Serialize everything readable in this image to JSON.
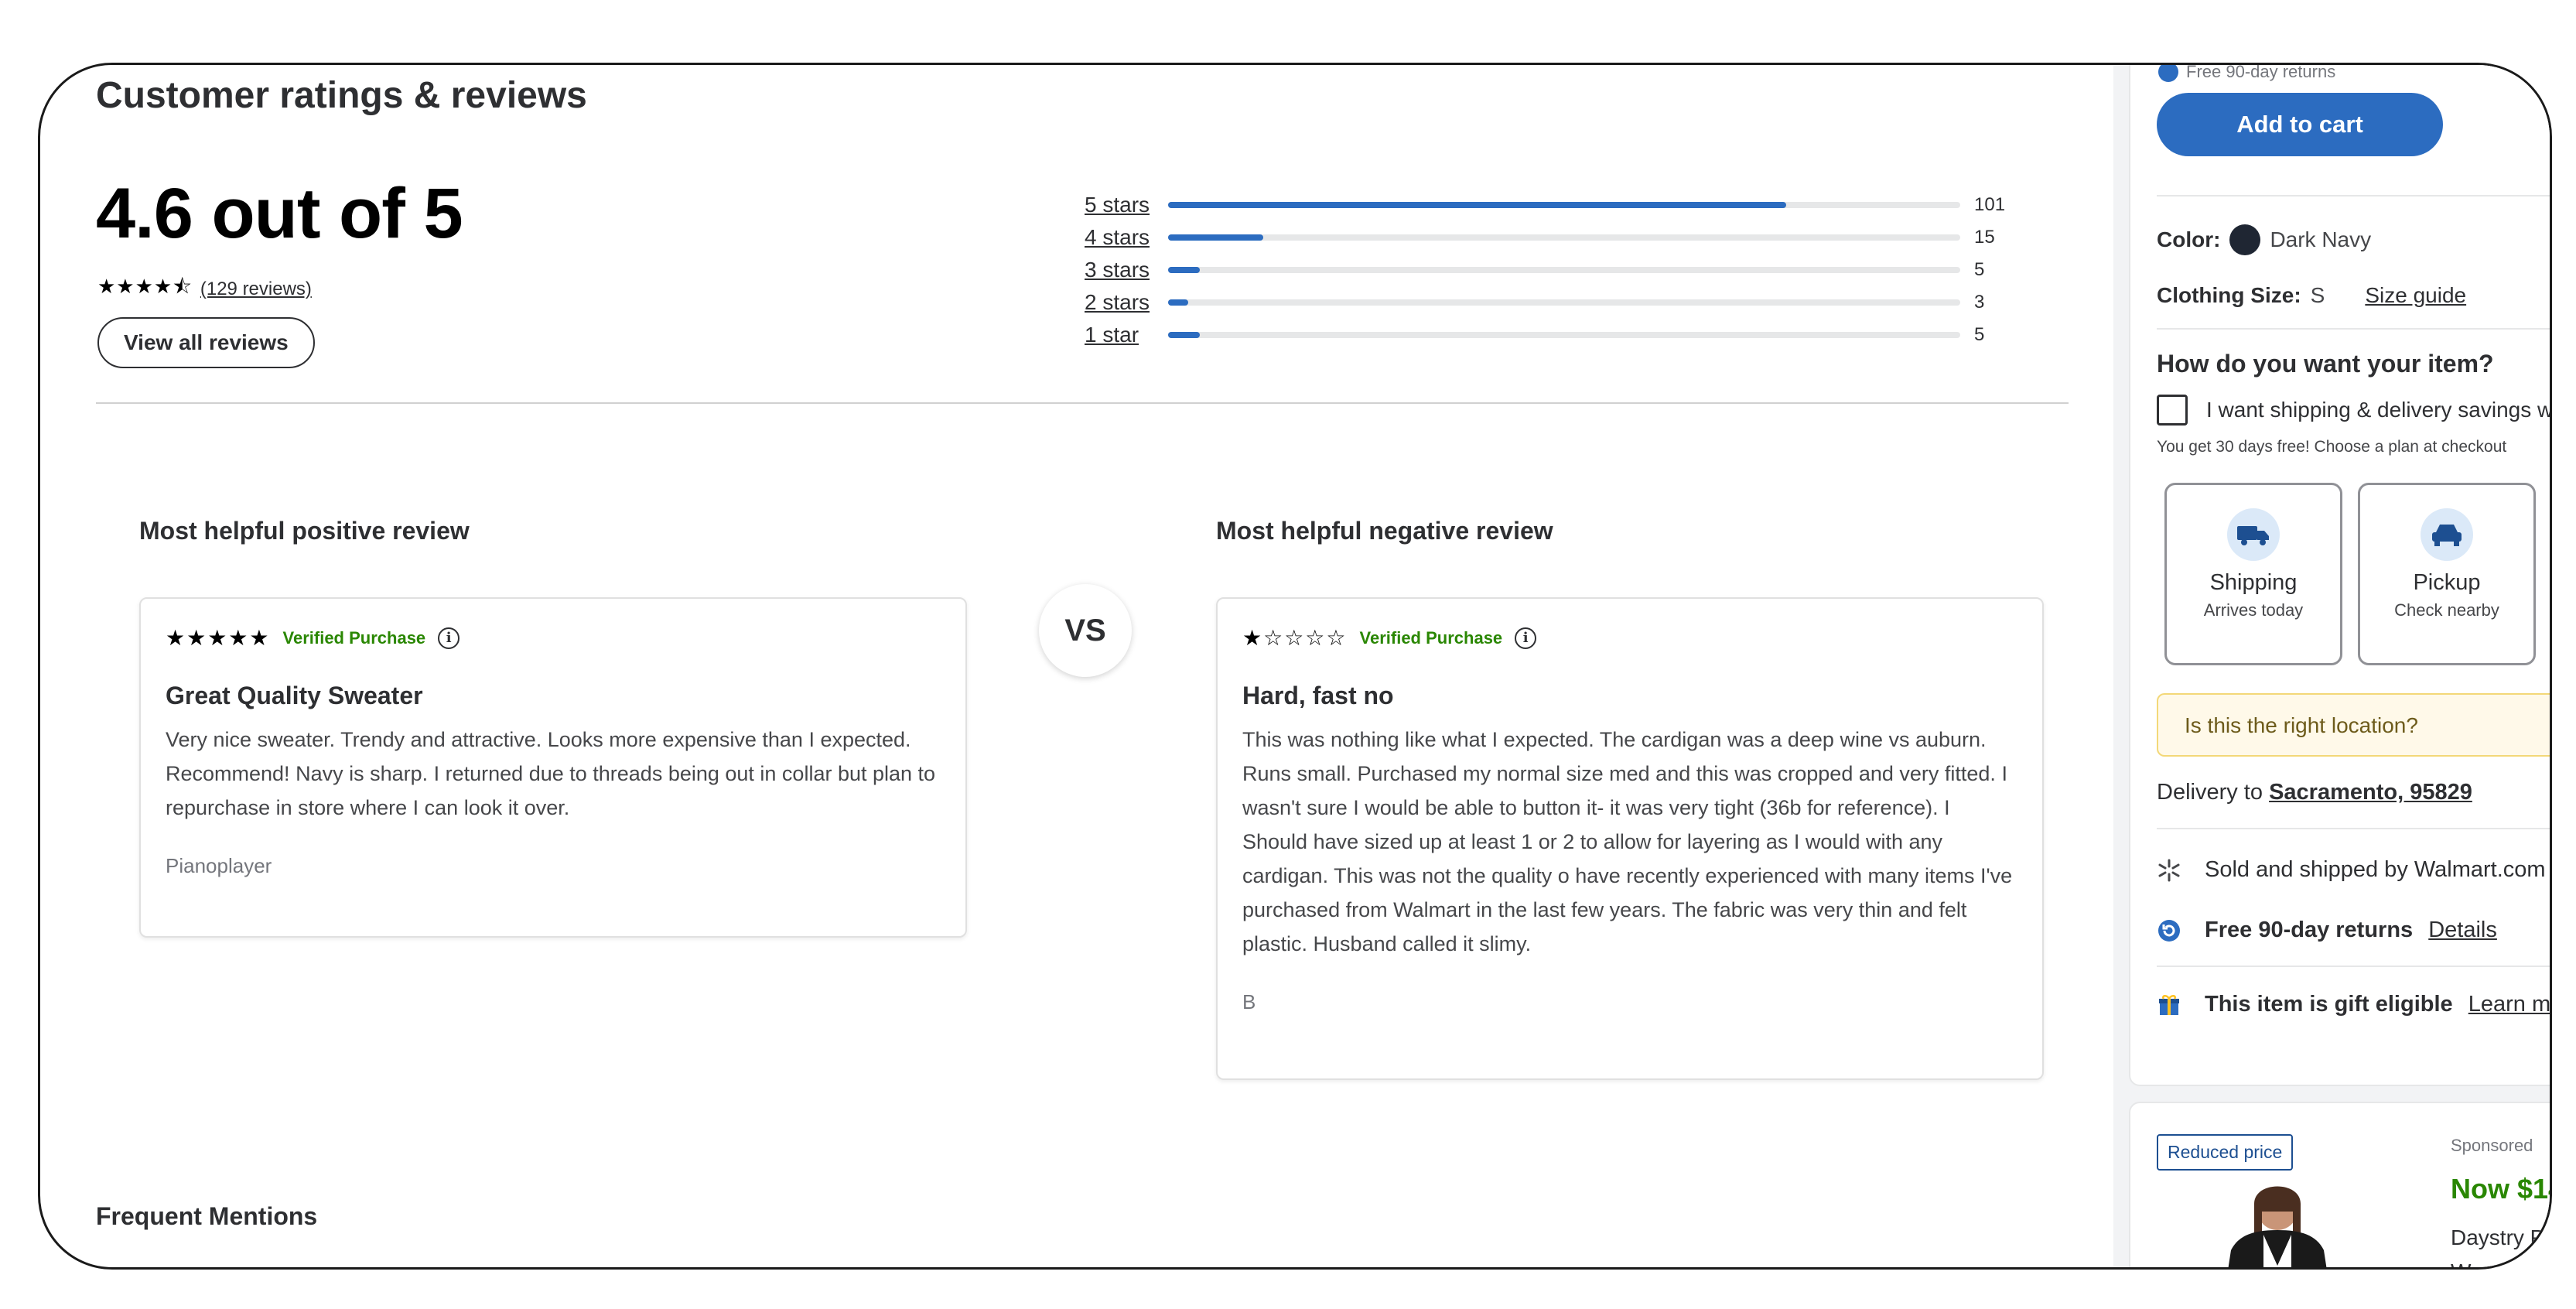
{
  "reviews": {
    "section_title": "Customer ratings & reviews",
    "average_text": "4.6 out of 5",
    "average_value": 4.6,
    "stars_display": "★★★★⯪",
    "count_text": "(129 reviews)",
    "view_all_label": "View all reviews",
    "histogram": [
      {
        "label": "5 stars",
        "count": "101",
        "fraction": 0.78
      },
      {
        "label": "4 stars",
        "count": "15",
        "fraction": 0.12
      },
      {
        "label": "3 stars",
        "count": "5",
        "fraction": 0.04
      },
      {
        "label": "2 stars",
        "count": "3",
        "fraction": 0.025
      },
      {
        "label": "1 star",
        "count": "5",
        "fraction": 0.04
      }
    ],
    "positive": {
      "heading": "Most helpful positive review",
      "stars": "★★★★★",
      "rating": 5,
      "verified": "Verified Purchase",
      "title": "Great Quality Sweater",
      "body": "Very nice sweater. Trendy and attractive. Looks more expensive than I expected. Recommend! Navy is sharp. I returned due to threads being out in collar but plan to repurchase in store where I can look it over.",
      "author": "Pianoplayer"
    },
    "vs_label": "VS",
    "negative": {
      "heading": "Most helpful negative review",
      "stars": "★☆☆☆☆",
      "rating": 1,
      "verified": "Verified Purchase",
      "title": "Hard, fast no",
      "body": "This was nothing like what I expected. The cardigan was a deep wine vs auburn. Runs small. Purchased my normal size med and this was cropped and very fitted. I wasn't sure I would be able to button it- it was very tight (36b for reference). I Should have sized up at least 1 or 2 to allow for layering as I would with any cardigan. This was not the quality o have recently experienced with many items I've purchased from Walmart in the last few years. The fabric was very thin and felt plastic. Husband called it slimy.",
      "author": "B"
    },
    "frequent_mentions": "Frequent Mentions"
  },
  "buybox": {
    "top_returns": "Free 90-day returns",
    "add_to_cart": "Add to cart",
    "color_label": "Color:",
    "color_value": "Dark Navy",
    "color_hex": "#1f2633",
    "size_label": "Clothing Size:",
    "size_value": "S",
    "size_guide": "Size guide",
    "how_heading": "How do you want your item?",
    "savings_label": "I want shipping & delivery savings wi",
    "savings_note": "You get 30 days free! Choose a plan at checkout",
    "options": [
      {
        "name": "Shipping",
        "sub": "Arrives today",
        "icon": "truck-icon"
      },
      {
        "name": "Pickup",
        "sub": "Check nearby",
        "icon": "car-icon"
      }
    ],
    "location_prompt": "Is this the right location?",
    "delivery_prefix": "Delivery to",
    "delivery_location": "Sacramento, 95829",
    "sold_by": "Sold and shipped by Walmart.com",
    "returns_label": "Free 90-day returns",
    "returns_link": "Details",
    "gift_label": "This item is gift eligible",
    "gift_link": "Learn more"
  },
  "ad": {
    "badge": "Reduced price",
    "sponsored": "Sponsored",
    "price": "Now $14.",
    "name": "Daystry Plus for Women",
    "stars": "★★★"
  },
  "colors": {
    "accent_blue": "#2c6cc0",
    "verified_green": "#2a8703",
    "location_bg": "#fff9e9"
  }
}
